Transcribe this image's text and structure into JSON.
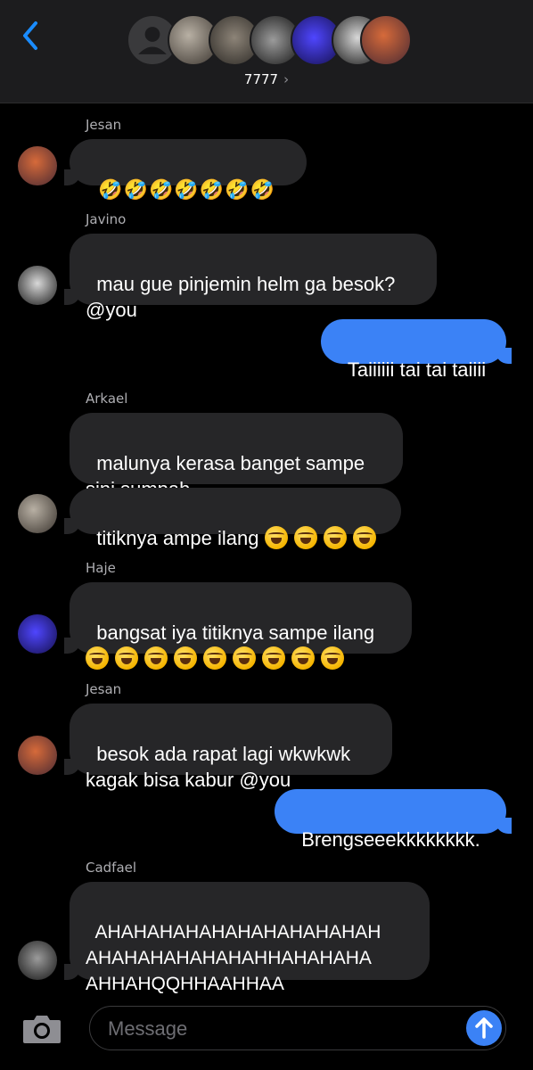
{
  "header": {
    "title": "7777",
    "back_icon": "chevron-left-icon",
    "title_chevron": "›",
    "accent": "#1a8cff"
  },
  "participants": [
    {
      "icon": "default-contact-avatar-icon"
    },
    {
      "icon": "member-photo"
    },
    {
      "icon": "member-photo"
    },
    {
      "icon": "member-photo"
    },
    {
      "icon": "member-photo"
    },
    {
      "icon": "member-photo"
    },
    {
      "icon": "member-photo"
    }
  ],
  "messages": {
    "m1": {
      "sender": "Jesan",
      "text": "🤣🤣🤣🤣🤣🤣🤣"
    },
    "m2": {
      "sender": "Javino",
      "text": "mau gue pinjemin helm ga besok?\n@you"
    },
    "m3": {
      "text": "Taiiiiii tai tai taiiii"
    },
    "m4": {
      "sender": "Arkael",
      "text": "malunya kerasa banget sampe\nsini sumpah"
    },
    "m5": {
      "text": "titiknya ampe ilang"
    },
    "m6": {
      "sender": "Haje",
      "text": "bangsat iya titiknya sampe ilang"
    },
    "m7": {
      "sender": "Jesan",
      "text": "besok ada rapat lagi wkwkwk\nkagak bisa kabur @you"
    },
    "m8": {
      "text": "Brengseeekkkkkkkk."
    },
    "m9": {
      "sender": "Cadfael",
      "text": "AHAHAHAHAHAHAHAHAHAHAH\nAHAHAHAHAHAHAHHAHAHAHA\nAHHAHQQHHAAHHAA"
    }
  },
  "composer": {
    "placeholder": "Message",
    "camera_icon": "camera-icon",
    "send_icon": "arrow-up-icon"
  },
  "colors": {
    "background": "#000000",
    "incoming_bubble": "#262628",
    "outgoing_bubble": "#3b82f6",
    "header_bg": "#1c1c1e"
  }
}
